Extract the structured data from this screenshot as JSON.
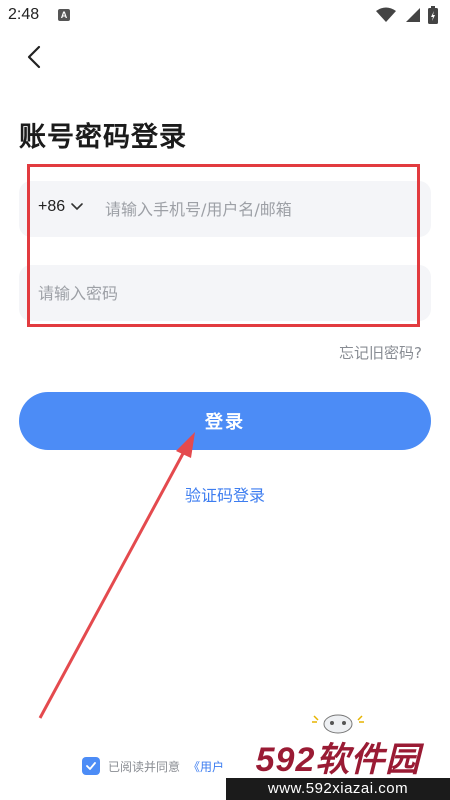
{
  "status_bar": {
    "time": "2:48",
    "app_badge": "A"
  },
  "header": {
    "title": "账号密码登录"
  },
  "form": {
    "country_code": "+86",
    "account_placeholder": "请输入手机号/用户名/邮箱",
    "password_placeholder": "请输入密码",
    "forgot_password": "忘记旧密码?",
    "login_button": "登录",
    "sms_login": "验证码登录"
  },
  "agreement": {
    "text": "已阅读并同意",
    "link_text": "《用户"
  },
  "watermark": {
    "brand": "592软件园",
    "url": "www.592xiazai.com"
  },
  "colors": {
    "primary": "#4c8cf6",
    "link": "#3d7df0",
    "annotation": "#e23b3f",
    "field_bg": "#f4f5f8"
  }
}
